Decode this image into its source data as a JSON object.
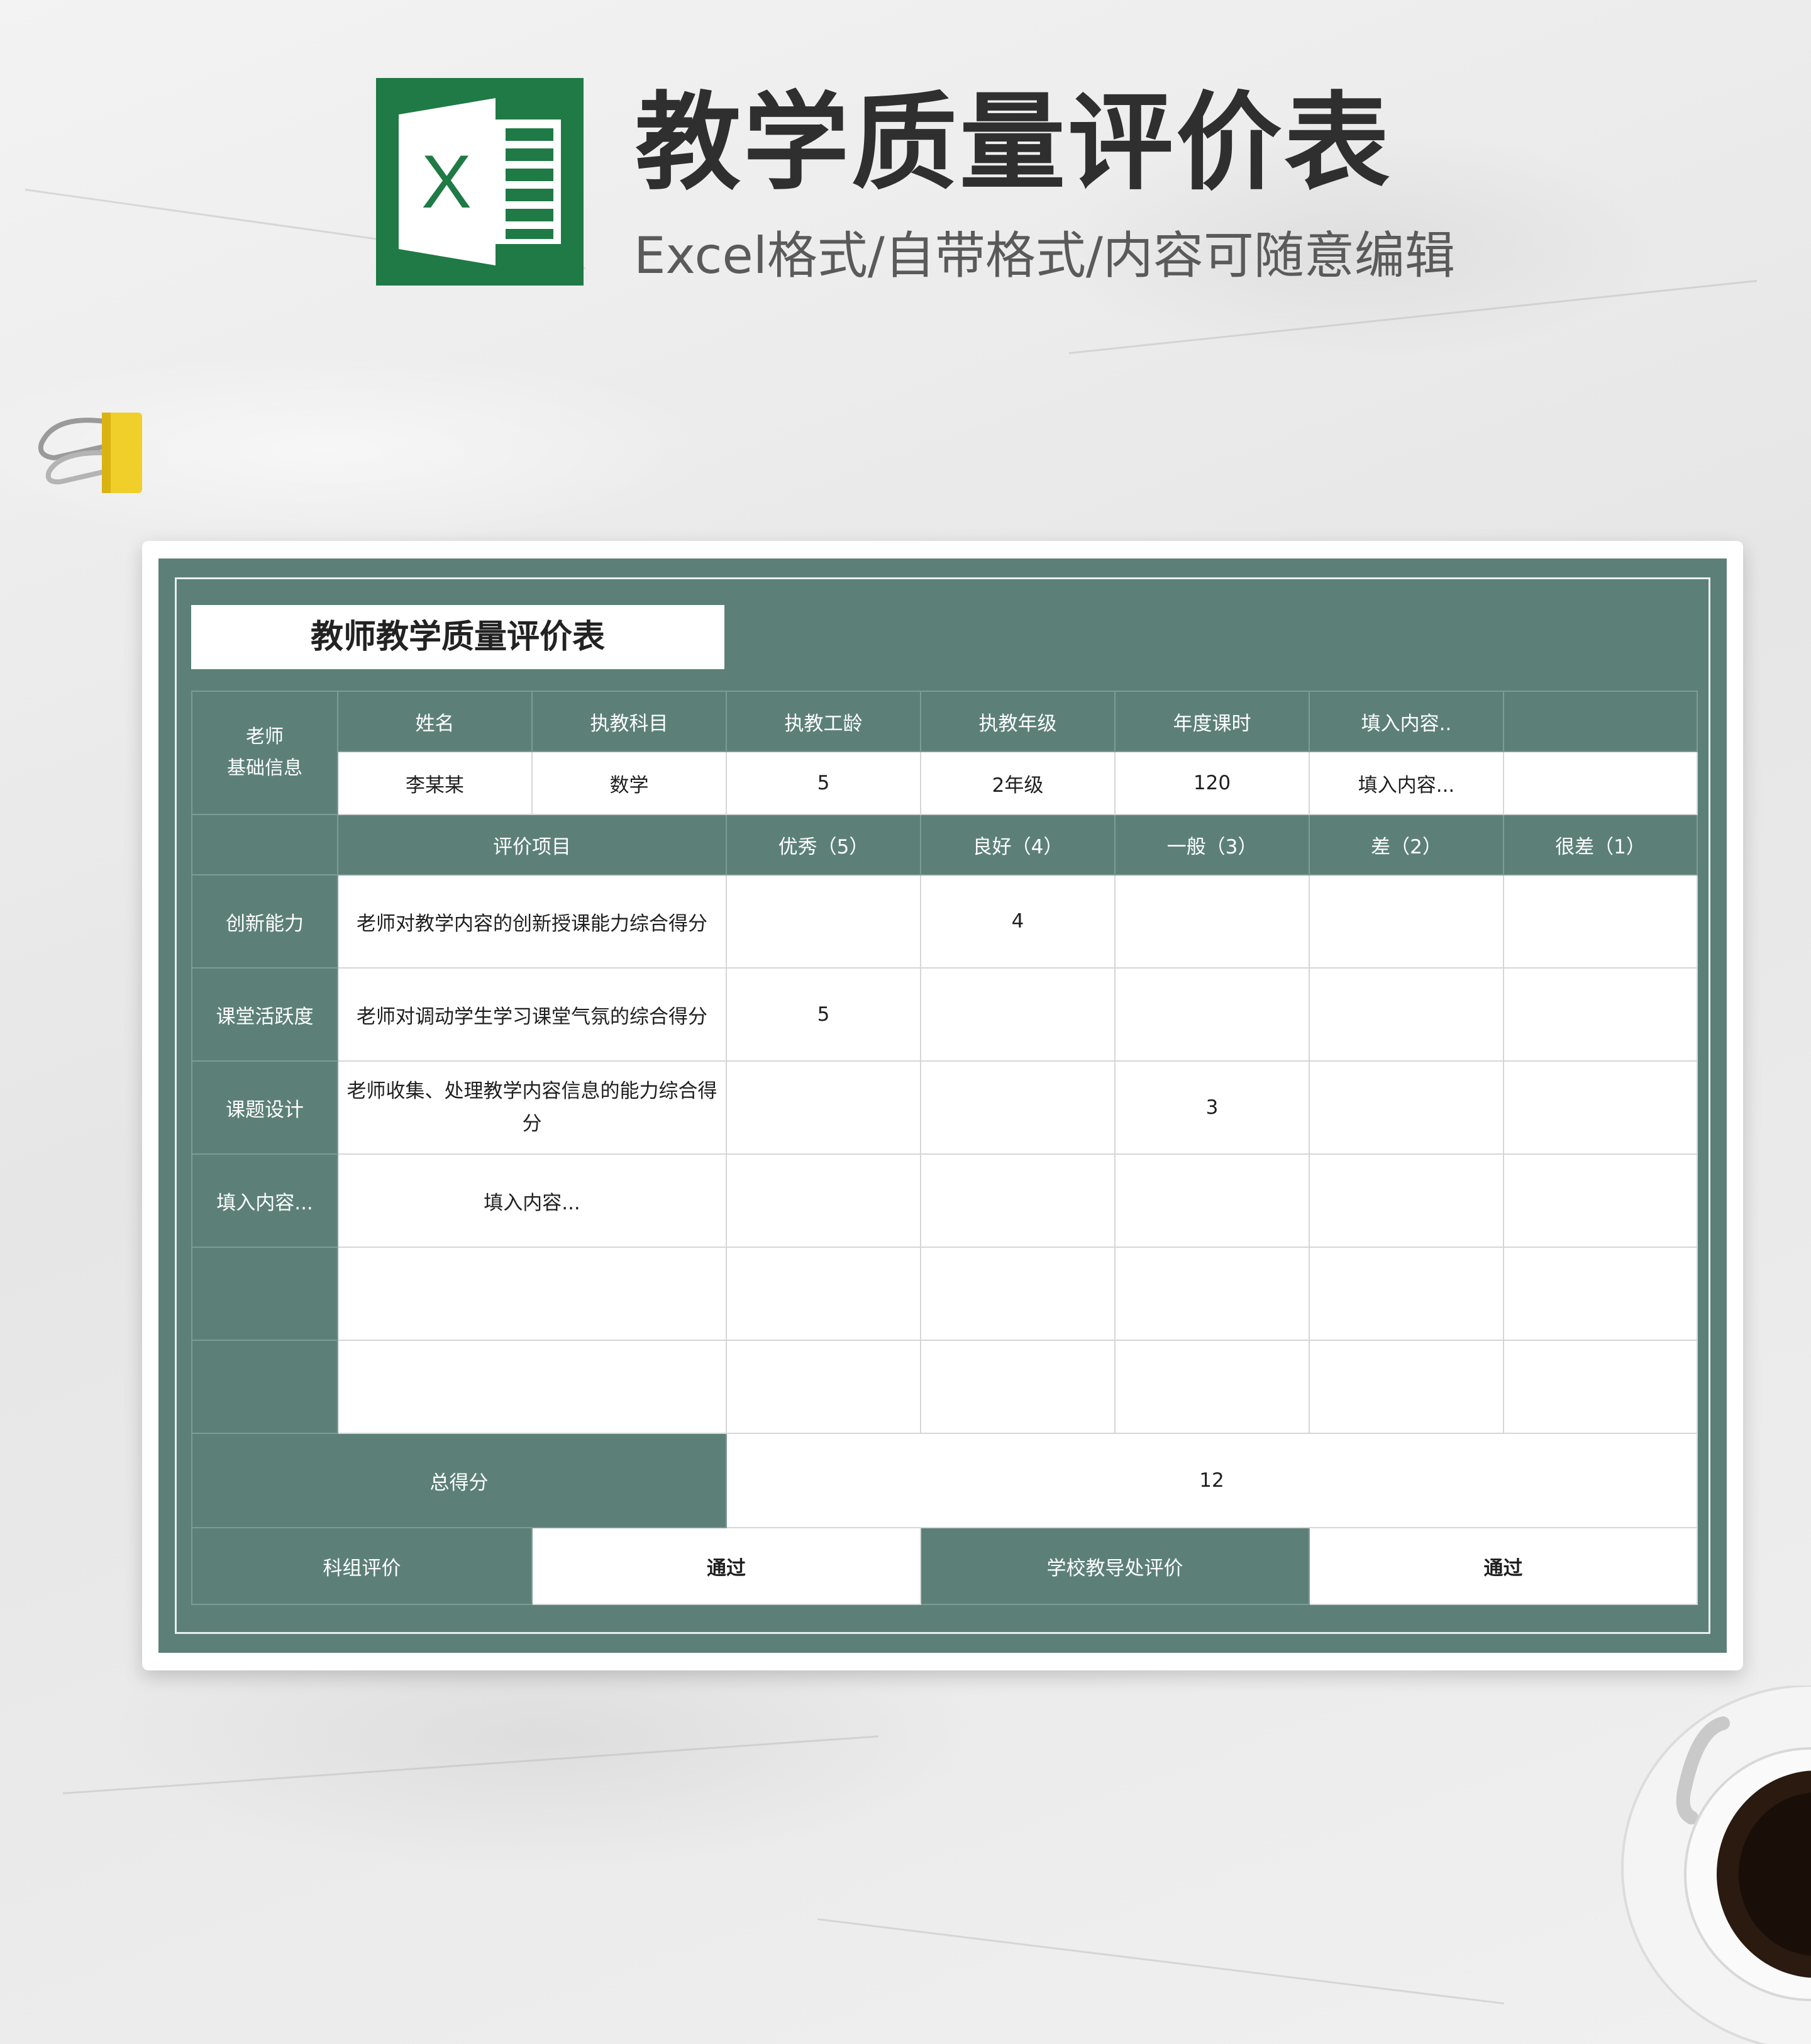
{
  "header": {
    "title": "教学质量评价表",
    "subtitle": "Excel格式/自带格式/内容可随意编辑",
    "logo_letter": "X",
    "logo_color": "#1f7a45"
  },
  "sheet": {
    "title": "教师教学质量评价表",
    "teacher_section_label": "老师基础信息",
    "teacher_section_line1": "老师",
    "teacher_section_line2": "基础信息",
    "info_headers": [
      "姓名",
      "执教科目",
      "执教工龄",
      "执教年级",
      "年度课时",
      "填入内容..",
      ""
    ],
    "info_values": [
      "李某某",
      "数学",
      "5",
      "2年级",
      "120",
      "填入内容...",
      ""
    ],
    "eval_headers": [
      "评价项目",
      "优秀（5）",
      "良好（4）",
      "一般（3）",
      "差（2）",
      "很差（1）"
    ],
    "eval_rows": [
      {
        "category": "创新能力",
        "item": "老师对教学内容的创新授课能力综合得分",
        "scores": [
          "",
          "4",
          "",
          "",
          ""
        ]
      },
      {
        "category": "课堂活跃度",
        "item": "老师对调动学生学习课堂气氛的综合得分",
        "scores": [
          "5",
          "",
          "",
          "",
          ""
        ]
      },
      {
        "category": "课题设计",
        "item": "老师收集、处理教学内容信息的能力综合得分",
        "scores": [
          "",
          "",
          "3",
          "",
          ""
        ]
      },
      {
        "category": "填入内容...",
        "item": "填入内容...",
        "scores": [
          "",
          "",
          "",
          "",
          ""
        ]
      },
      {
        "category": "",
        "item": "",
        "scores": [
          "",
          "",
          "",
          "",
          ""
        ]
      },
      {
        "category": "",
        "item": "",
        "scores": [
          "",
          "",
          "",
          "",
          ""
        ]
      }
    ],
    "total_label": "总得分",
    "total_value": "12",
    "group_eval_label": "科组评价",
    "group_eval_value": "通过",
    "school_eval_label": "学校教导处评价",
    "school_eval_value": "通过",
    "theme_color": "#5c8078"
  }
}
